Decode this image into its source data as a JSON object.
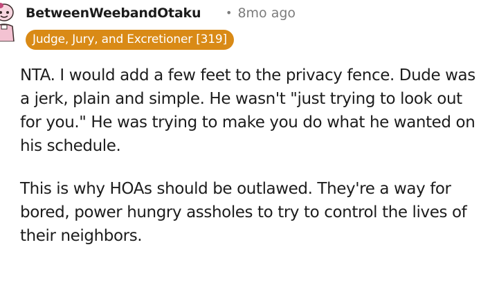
{
  "comment": {
    "author": "BetweenWeebandOtaku",
    "separator": "•",
    "timestamp": "8mo ago",
    "flair": "Judge, Jury, and Excretioner [319]",
    "paragraphs": [
      "NTA. I would add a few feet to the privacy fence. Dude was a jerk, plain and simple. He wasn't \"just trying to look out for you.\" He was trying to make you do what he wanted on his schedule.",
      "This is why HOAs should be outlawed. They're a way for bored, power hungry assholes to try to control the lives of their neighbors."
    ],
    "avatar_icon": "avatar-icon",
    "colors": {
      "flair_background": "#d98a16",
      "flair_text": "#ffffff",
      "author_text": "#1c1c1c",
      "meta_text": "#7c7c7c",
      "body_text": "#1c1c1c"
    }
  }
}
